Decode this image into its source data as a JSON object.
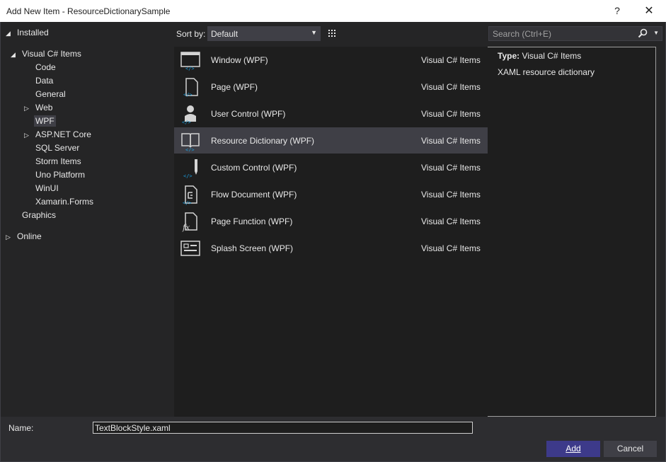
{
  "window": {
    "title": "Add New Item - ResourceDictionarySample",
    "help_label": "?",
    "close_label": "✕"
  },
  "tree": {
    "installed": "Installed",
    "visual_csharp_items": "Visual C# Items",
    "children": [
      "Code",
      "Data",
      "General",
      "Web",
      "WPF",
      "ASP.NET Core",
      "SQL Server",
      "Storm Items",
      "Uno Platform",
      "WinUI",
      "Xamarin.Forms"
    ],
    "graphics": "Graphics",
    "online": "Online",
    "selected": "WPF"
  },
  "toolbar": {
    "sort_by_label": "Sort by:",
    "sort_value": "Default",
    "search_placeholder": "Search (Ctrl+E)"
  },
  "items": [
    {
      "name": "Window (WPF)",
      "category": "Visual C# Items",
      "icon": "window-icon"
    },
    {
      "name": "Page (WPF)",
      "category": "Visual C# Items",
      "icon": "page-icon"
    },
    {
      "name": "User Control (WPF)",
      "category": "Visual C# Items",
      "icon": "user-control-icon"
    },
    {
      "name": "Resource Dictionary (WPF)",
      "category": "Visual C# Items",
      "icon": "resource-dictionary-icon",
      "selected": true
    },
    {
      "name": "Custom Control (WPF)",
      "category": "Visual C# Items",
      "icon": "custom-control-icon"
    },
    {
      "name": "Flow Document (WPF)",
      "category": "Visual C# Items",
      "icon": "flow-document-icon"
    },
    {
      "name": "Page Function (WPF)",
      "category": "Visual C# Items",
      "icon": "page-function-icon"
    },
    {
      "name": "Splash Screen (WPF)",
      "category": "Visual C# Items",
      "icon": "splash-screen-icon"
    }
  ],
  "details": {
    "type_label": "Type:",
    "type_value": "Visual C# Items",
    "description": "XAML resource dictionary"
  },
  "footer": {
    "name_label": "Name:",
    "name_value": "TextBlockStyle.xaml",
    "add_label": "Add",
    "cancel_label": "Cancel"
  },
  "colors": {
    "accent": "#3d3a8a",
    "icon_blue": "#1ba1e2",
    "selection": "#3f3f46"
  }
}
